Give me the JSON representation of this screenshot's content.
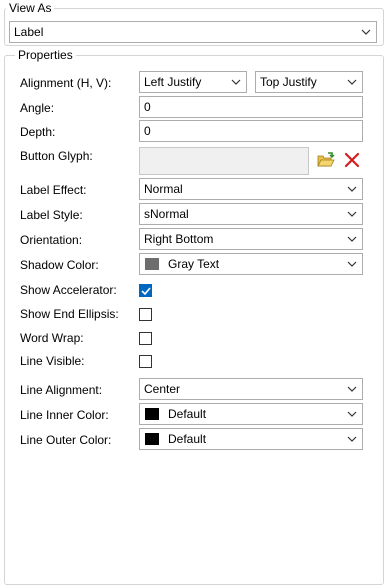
{
  "view_as": {
    "legend": "View As",
    "selected": "Label"
  },
  "properties": {
    "legend": "Properties",
    "alignment": {
      "label": "Alignment (H, V):",
      "horizontal": "Left Justify",
      "vertical": "Top Justify"
    },
    "angle": {
      "label": "Angle:",
      "value": "0"
    },
    "depth": {
      "label": "Depth:",
      "value": "0"
    },
    "button_glyph": {
      "label": "Button Glyph:"
    },
    "label_effect": {
      "label": "Label Effect:",
      "value": "Normal"
    },
    "label_style": {
      "label": "Label Style:",
      "value": "sNormal"
    },
    "orientation": {
      "label": "Orientation:",
      "value": "Right Bottom"
    },
    "shadow_color": {
      "label": "Shadow Color:",
      "value": "Gray Text",
      "swatch": "#6d6d6d"
    },
    "show_accelerator": {
      "label": "Show Accelerator:",
      "checked": true
    },
    "show_end_ellipsis": {
      "label": "Show End Ellipsis:",
      "checked": false
    },
    "word_wrap": {
      "label": "Word Wrap:",
      "checked": false
    },
    "line_visible": {
      "label": "Line Visible:",
      "checked": false
    },
    "line_alignment": {
      "label": "Line Alignment:",
      "value": "Center"
    },
    "line_inner_color": {
      "label": "Line Inner Color:",
      "value": "Default",
      "swatch": "#000000"
    },
    "line_outer_color": {
      "label": "Line Outer Color:",
      "value": "Default",
      "swatch": "#000000"
    }
  },
  "colors": {
    "accent": "#0067c0",
    "border": "#acacac",
    "group_border": "#d5d5d5"
  },
  "icons": {
    "dropdown": "chevron-down-icon",
    "load_glyph": "folder-open-icon",
    "clear_glyph": "delete-x-icon",
    "check": "checkmark-icon"
  }
}
